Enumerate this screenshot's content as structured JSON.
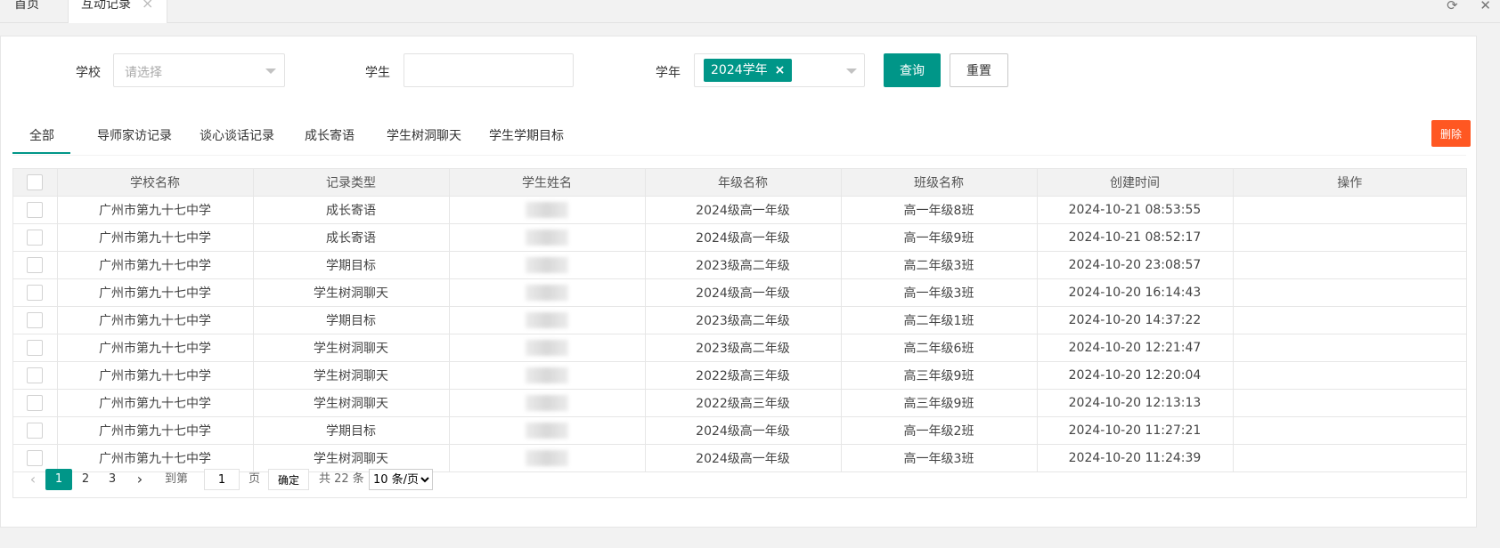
{
  "tabbar": {
    "home": "首页",
    "active_tab": "互动记录",
    "close_glyph": "×",
    "refresh_glyph": "⟳",
    "window_close_glyph": "✕"
  },
  "filter": {
    "school_label": "学校",
    "school_placeholder": "请选择",
    "student_label": "学生",
    "student_value": "",
    "year_label": "学年",
    "year_chip": "2024学年",
    "chip_remove": "×",
    "query_button": "查询",
    "reset_button": "重置"
  },
  "subtabs": [
    "全部",
    "导师家访记录",
    "谈心谈话记录",
    "成长寄语",
    "学生树洞聊天",
    "学生学期目标"
  ],
  "delete_button": "删除",
  "table": {
    "headers": [
      "学校名称",
      "记录类型",
      "学生姓名",
      "年级名称",
      "班级名称",
      "创建时间",
      "操作"
    ],
    "rows": [
      {
        "school": "广州市第九十七中学",
        "type": "成长寄语",
        "grade": "2024级高一年级",
        "class": "高一年级8班",
        "time": "2024-10-21 08:53:55"
      },
      {
        "school": "广州市第九十七中学",
        "type": "成长寄语",
        "grade": "2024级高一年级",
        "class": "高一年级9班",
        "time": "2024-10-21 08:52:17"
      },
      {
        "school": "广州市第九十七中学",
        "type": "学期目标",
        "grade": "2023级高二年级",
        "class": "高二年级3班",
        "time": "2024-10-20 23:08:57"
      },
      {
        "school": "广州市第九十七中学",
        "type": "学生树洞聊天",
        "grade": "2024级高一年级",
        "class": "高一年级3班",
        "time": "2024-10-20 16:14:43"
      },
      {
        "school": "广州市第九十七中学",
        "type": "学期目标",
        "grade": "2023级高二年级",
        "class": "高二年级1班",
        "time": "2024-10-20 14:37:22"
      },
      {
        "school": "广州市第九十七中学",
        "type": "学生树洞聊天",
        "grade": "2023级高二年级",
        "class": "高二年级6班",
        "time": "2024-10-20 12:21:47"
      },
      {
        "school": "广州市第九十七中学",
        "type": "学生树洞聊天",
        "grade": "2022级高三年级",
        "class": "高三年级9班",
        "time": "2024-10-20 12:20:04"
      },
      {
        "school": "广州市第九十七中学",
        "type": "学生树洞聊天",
        "grade": "2022级高三年级",
        "class": "高三年级9班",
        "time": "2024-10-20 12:13:13"
      },
      {
        "school": "广州市第九十七中学",
        "type": "学期目标",
        "grade": "2024级高一年级",
        "class": "高一年级2班",
        "time": "2024-10-20 11:27:21"
      },
      {
        "school": "广州市第九十七中学",
        "type": "学生树洞聊天",
        "grade": "2024级高一年级",
        "class": "高一年级3班",
        "time": "2024-10-20 11:24:39"
      }
    ]
  },
  "pager": {
    "prev": "‹",
    "pages": [
      "1",
      "2",
      "3"
    ],
    "next": "›",
    "goto_label": "到第",
    "goto_value": "1",
    "page_unit": "页",
    "confirm": "确定",
    "total": "共 22 条",
    "page_size": "10 条/页"
  }
}
